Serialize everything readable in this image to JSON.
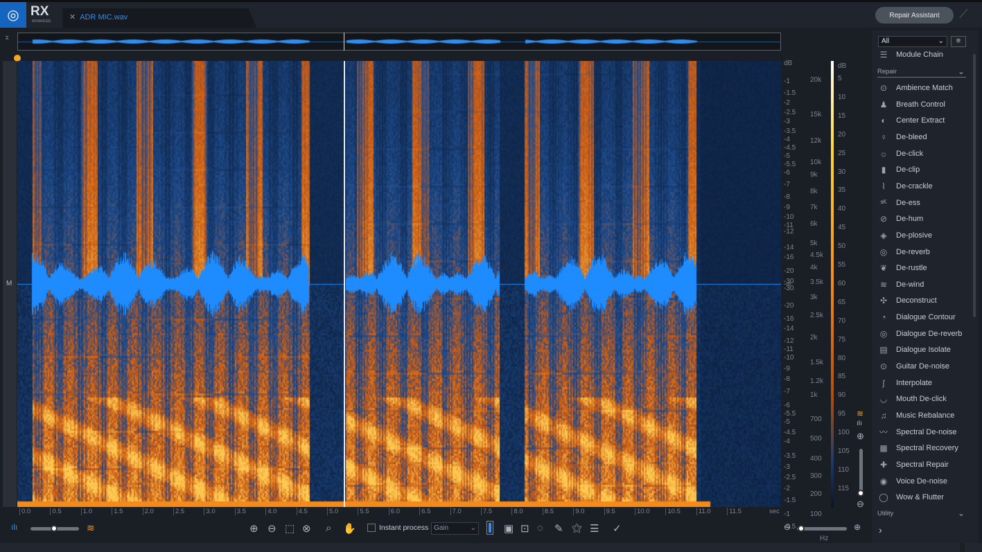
{
  "app": {
    "logo": "RX",
    "edition": "ADVANCED",
    "file_tab": "ADR MIC.wav",
    "repair_assistant": "Repair Assistant"
  },
  "colors": {
    "accent": "#2f8ef0",
    "spectrum_hot": "#f38a1a",
    "waveform": "#1e90ff",
    "playhead": "#f5a623"
  },
  "view": {
    "channel_label": "M",
    "cursor_time_sec": 5.25
  },
  "axes": {
    "db_left": [
      "dB",
      "-1",
      "-1.5",
      "-2",
      "-2.5",
      "-3",
      "-3.5",
      "-4",
      "-4.5",
      "-5",
      "-5.5",
      "-6",
      "-7",
      "-8",
      "-9",
      "-10",
      "-11",
      "-12",
      "-14",
      "-16",
      "-20",
      "-30",
      "-∞",
      "-30",
      "-20",
      "-16",
      "-14",
      "-12",
      "-11",
      "-10",
      "-9",
      "-8",
      "-7",
      "-6",
      "-5.5",
      "-5",
      "-4.5",
      "-4",
      "-3.5",
      "-3",
      "-2.5",
      "-2",
      "-1.5",
      "-1",
      "-0.5"
    ],
    "freq": [
      "20k",
      "15k",
      "12k",
      "10k",
      "9k",
      "8k",
      "7k",
      "6k",
      "5k",
      "4.5k",
      "4k",
      "3.5k",
      "3k",
      "2.5k",
      "2k",
      "1.5k",
      "1.2k",
      "1k",
      "700",
      "500",
      "400",
      "300",
      "200",
      "100",
      "Hz"
    ],
    "db_colorbar": [
      "dB",
      "5",
      "10",
      "15",
      "20",
      "25",
      "30",
      "35",
      "40",
      "45",
      "50",
      "55",
      "60",
      "65",
      "70",
      "75",
      "80",
      "85",
      "90",
      "95",
      "100",
      "105",
      "110",
      "115"
    ],
    "time": [
      "0.0",
      "0.5",
      "1.0",
      "1.5",
      "2.0",
      "2.5",
      "3.0",
      "3.5",
      "4.0",
      "4.5",
      "5.0",
      "5.5",
      "6.0",
      "6.5",
      "7.0",
      "7.5",
      "8.0",
      "8.5",
      "9.0",
      "9.5",
      "10.0",
      "10.5",
      "11.0",
      "11.5",
      "sec"
    ]
  },
  "toolbar": {
    "instant_process": "Instant process",
    "instant_checked": false,
    "mode": "Gain",
    "waveform_spectrogram_blend": 0.45,
    "horizontal_zoom": 0.05
  },
  "panel": {
    "filter": "All",
    "module_chain": "Module Chain",
    "repair_category": "Repair",
    "utility_category": "Utility",
    "modules": [
      {
        "label": "Ambience Match",
        "icon": "ambience-icon"
      },
      {
        "label": "Breath Control",
        "icon": "breath-icon"
      },
      {
        "label": "Center Extract",
        "icon": "center-icon"
      },
      {
        "label": "De-bleed",
        "icon": "mic-icon"
      },
      {
        "label": "De-click",
        "icon": "click-icon"
      },
      {
        "label": "De-clip",
        "icon": "clip-icon"
      },
      {
        "label": "De-crackle",
        "icon": "crackle-icon"
      },
      {
        "label": "De-ess",
        "icon": "ess-icon"
      },
      {
        "label": "De-hum",
        "icon": "hum-icon"
      },
      {
        "label": "De-plosive",
        "icon": "plosive-icon"
      },
      {
        "label": "De-reverb",
        "icon": "reverb-icon"
      },
      {
        "label": "De-rustle",
        "icon": "rustle-icon"
      },
      {
        "label": "De-wind",
        "icon": "wind-icon"
      },
      {
        "label": "Deconstruct",
        "icon": "deconstruct-icon"
      },
      {
        "label": "Dialogue Contour",
        "icon": "contour-icon"
      },
      {
        "label": "Dialogue De-reverb",
        "icon": "reverb-icon"
      },
      {
        "label": "Dialogue Isolate",
        "icon": "isolate-icon"
      },
      {
        "label": "Guitar De-noise",
        "icon": "guitar-icon"
      },
      {
        "label": "Interpolate",
        "icon": "interpolate-icon"
      },
      {
        "label": "Mouth De-click",
        "icon": "mouth-icon"
      },
      {
        "label": "Music Rebalance",
        "icon": "music-icon"
      },
      {
        "label": "Spectral De-noise",
        "icon": "denoise-icon"
      },
      {
        "label": "Spectral Recovery",
        "icon": "recovery-icon"
      },
      {
        "label": "Spectral Repair",
        "icon": "repair-icon"
      },
      {
        "label": "Voice De-noise",
        "icon": "voice-icon"
      },
      {
        "label": "Wow & Flutter",
        "icon": "wow-icon"
      }
    ]
  }
}
